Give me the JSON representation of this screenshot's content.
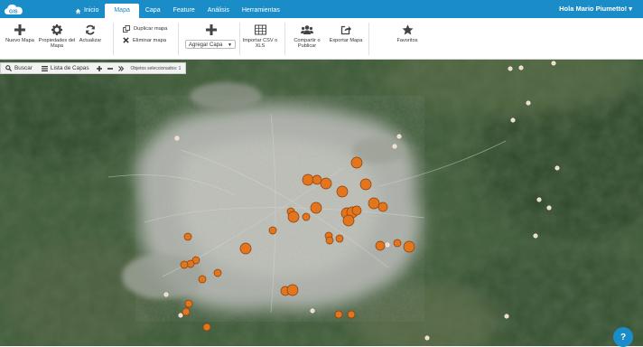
{
  "topbar": {
    "logo_text": "GIS",
    "nav": [
      {
        "label": "Inicio",
        "icon": "home-icon"
      },
      {
        "label": "Mapa",
        "active": true
      },
      {
        "label": "Capa"
      },
      {
        "label": "Feature"
      },
      {
        "label": "Análisis"
      },
      {
        "label": "Herramientas"
      }
    ],
    "user_label": "Hola Mario Piumetto! ▾"
  },
  "ribbon": {
    "nuevo_mapa": "Nuevo Mapa",
    "propiedades": "Propiedades del Mapa",
    "actualizar": "Actualizar",
    "duplicar": "Duplicar mapa",
    "eliminar": "Eliminar mapa",
    "agregar_capa": "Agregar Capa",
    "importar": "Importar CSV o XLS",
    "compartir": "Compartir o Publicar",
    "exportar": "Exportar Mapa",
    "favoritos": "Favoritos"
  },
  "layerbar": {
    "buscar": "Buscar",
    "lista": "Lista de Capas",
    "seleccionados": "Objetos seleccionados: 1"
  },
  "colors": {
    "accent": "#1a8dc8",
    "marker": "#e2761f",
    "marker_small": "#f3d9c2"
  },
  "help_icon": "?"
}
